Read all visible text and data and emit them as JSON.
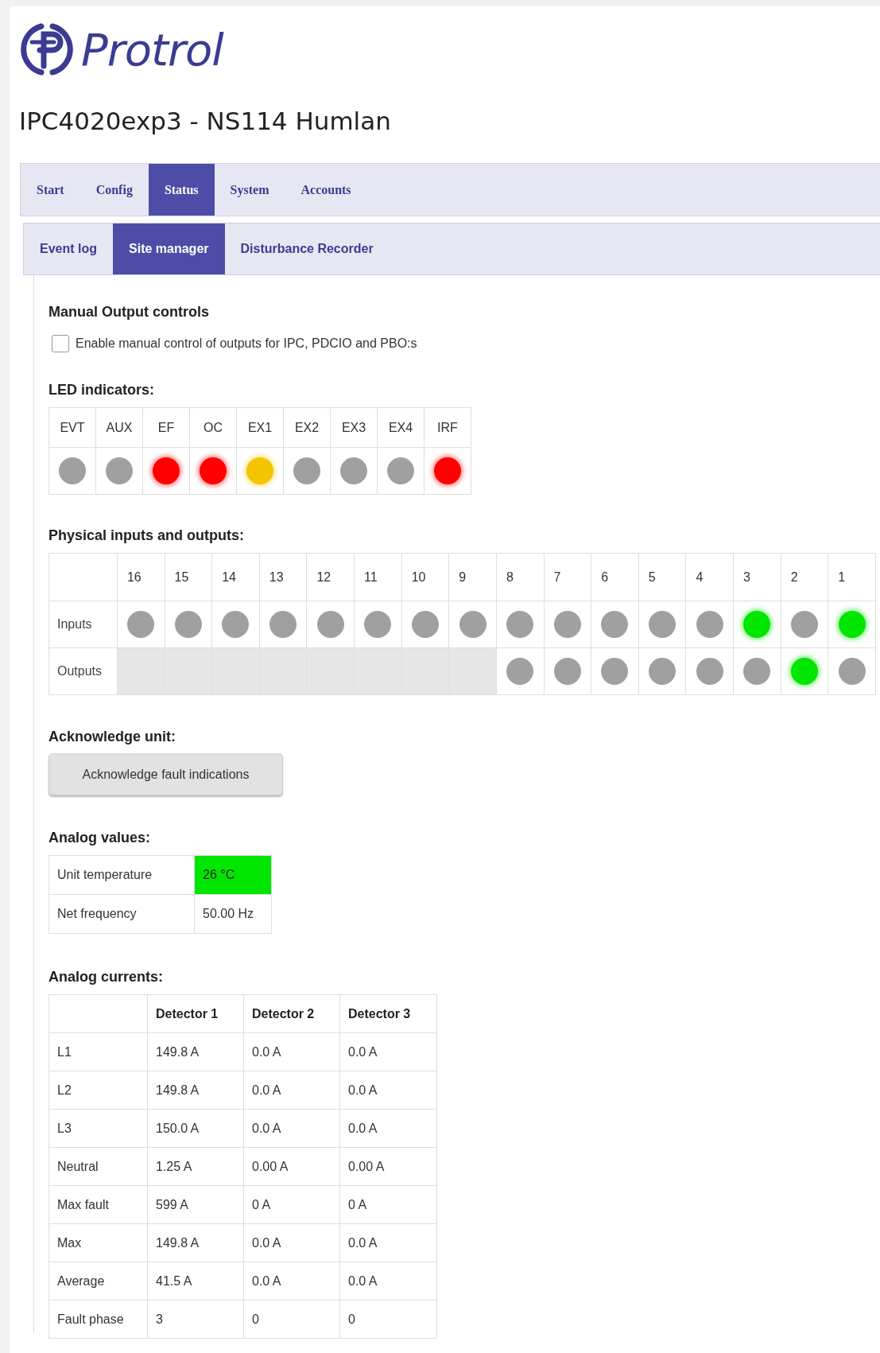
{
  "logo": {
    "text": "Protrol"
  },
  "title": "IPC4020exp3 - NS114 Humlan",
  "main_tabs": [
    {
      "label": "Start",
      "selected": false
    },
    {
      "label": "Config",
      "selected": false
    },
    {
      "label": "Status",
      "selected": true
    },
    {
      "label": "System",
      "selected": false
    },
    {
      "label": "Accounts",
      "selected": false
    }
  ],
  "sub_tabs": [
    {
      "label": "Event log",
      "selected": false
    },
    {
      "label": "Site manager",
      "selected": true
    },
    {
      "label": "Disturbance Recorder",
      "selected": false
    }
  ],
  "manual_output": {
    "heading": "Manual Output controls",
    "checkbox": {
      "label": "Enable manual control of outputs for IPC, PDCIO and PBO:s",
      "checked": false
    }
  },
  "led_indicators": {
    "heading": "LED indicators:",
    "leds": [
      {
        "label": "EVT",
        "lit": false,
        "color": "#a0a0a0"
      },
      {
        "label": "AUX",
        "lit": false,
        "color": "#a0a0a0"
      },
      {
        "label": "EF",
        "lit": true,
        "color": "#ff0000"
      },
      {
        "label": "OC",
        "lit": true,
        "color": "#ff0000"
      },
      {
        "label": "EX1",
        "lit": true,
        "color": "#f5c400"
      },
      {
        "label": "EX2",
        "lit": false,
        "color": "#a0a0a0"
      },
      {
        "label": "EX3",
        "lit": false,
        "color": "#a0a0a0"
      },
      {
        "label": "EX4",
        "lit": false,
        "color": "#a0a0a0"
      },
      {
        "label": "IRF",
        "lit": true,
        "color": "#ff0000"
      }
    ]
  },
  "physical_io": {
    "heading": "Physical inputs and outputs:",
    "columns": [
      "16",
      "15",
      "14",
      "13",
      "12",
      "11",
      "10",
      "9",
      "8",
      "7",
      "6",
      "5",
      "4",
      "3",
      "2",
      "1"
    ],
    "rows": [
      {
        "label": "Inputs",
        "points": [
          {
            "kind": "led",
            "on": false
          },
          {
            "kind": "led",
            "on": false
          },
          {
            "kind": "led",
            "on": false
          },
          {
            "kind": "led",
            "on": false
          },
          {
            "kind": "led",
            "on": false
          },
          {
            "kind": "led",
            "on": false
          },
          {
            "kind": "led",
            "on": false
          },
          {
            "kind": "led",
            "on": false
          },
          {
            "kind": "led",
            "on": false
          },
          {
            "kind": "led",
            "on": false
          },
          {
            "kind": "led",
            "on": false
          },
          {
            "kind": "led",
            "on": false
          },
          {
            "kind": "led",
            "on": false
          },
          {
            "kind": "led",
            "on": true
          },
          {
            "kind": "led",
            "on": false
          },
          {
            "kind": "led",
            "on": true
          }
        ]
      },
      {
        "label": "Outputs",
        "points": [
          {
            "kind": "none"
          },
          {
            "kind": "none"
          },
          {
            "kind": "none"
          },
          {
            "kind": "none"
          },
          {
            "kind": "none"
          },
          {
            "kind": "none"
          },
          {
            "kind": "none"
          },
          {
            "kind": "none"
          },
          {
            "kind": "led",
            "on": false
          },
          {
            "kind": "led",
            "on": false
          },
          {
            "kind": "led",
            "on": false
          },
          {
            "kind": "led",
            "on": false
          },
          {
            "kind": "led",
            "on": false
          },
          {
            "kind": "led",
            "on": false
          },
          {
            "kind": "led",
            "on": true
          },
          {
            "kind": "led",
            "on": false
          }
        ]
      }
    ]
  },
  "acknowledge": {
    "heading": "Acknowledge unit:",
    "button": "Acknowledge fault indications"
  },
  "analog_values": {
    "heading": "Analog values:",
    "rows": [
      {
        "label": "Unit temperature",
        "value": "26 °C",
        "highlight": true
      },
      {
        "label": "Net frequency",
        "value": "50.00 Hz",
        "highlight": false
      }
    ]
  },
  "analog_currents": {
    "heading": "Analog currents:",
    "columns": [
      "Detector 1",
      "Detector 2",
      "Detector 3"
    ],
    "rows": [
      {
        "label": "L1",
        "values": [
          "149.8 A",
          "0.0 A",
          "0.0 A"
        ]
      },
      {
        "label": "L2",
        "values": [
          "149.8 A",
          "0.0 A",
          "0.0 A"
        ]
      },
      {
        "label": "L3",
        "values": [
          "150.0 A",
          "0.0 A",
          "0.0 A"
        ]
      },
      {
        "label": "Neutral",
        "values": [
          "1.25 A",
          "0.00 A",
          "0.00 A"
        ]
      },
      {
        "label": "Max fault",
        "values": [
          "599 A",
          "0 A",
          "0 A"
        ]
      },
      {
        "label": "Max",
        "values": [
          "149.8 A",
          "0.0 A",
          "0.0 A"
        ]
      },
      {
        "label": "Average",
        "values": [
          "41.5 A",
          "0.0 A",
          "0.0 A"
        ]
      },
      {
        "label": "Fault phase",
        "values": [
          "3",
          "0",
          "0"
        ]
      }
    ]
  }
}
